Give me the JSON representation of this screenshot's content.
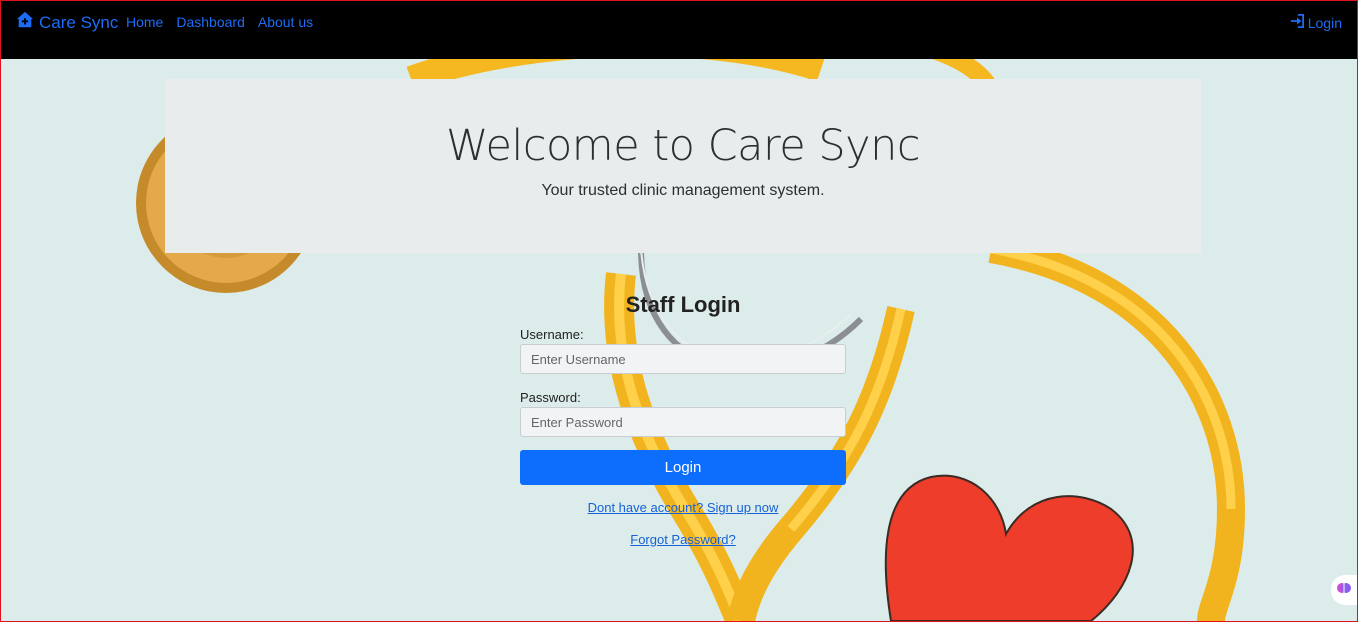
{
  "navbar": {
    "brand": "Care Sync",
    "brand_icon": "house-medical-icon",
    "links": [
      "Home",
      "Dashboard",
      "About us"
    ],
    "login": "Login",
    "login_icon": "sign-in-icon",
    "link_color": "#1e6cf5"
  },
  "hero": {
    "title": "Welcome to Care Sync",
    "subtitle": "Your trusted clinic management system."
  },
  "form": {
    "title": "Staff Login",
    "username_label": "Username:",
    "username_placeholder": "Enter Username",
    "password_label": "Password:",
    "password_placeholder": "Enter Password",
    "submit": "Login",
    "signup_link": "Dont have account? Sign up now",
    "forgot_link": "Forgot Password?",
    "button_color": "#0d6efd"
  },
  "floating_badge_icon": "brain-icon"
}
